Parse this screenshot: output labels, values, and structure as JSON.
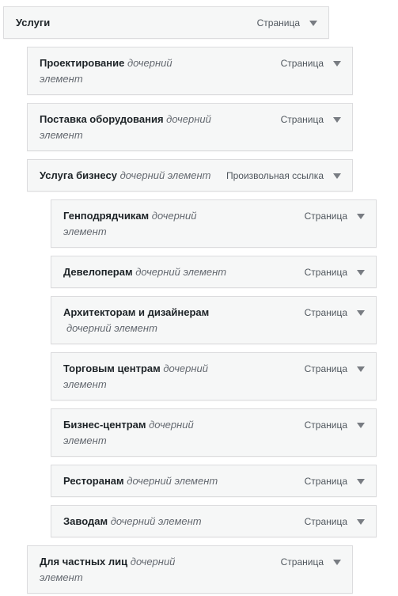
{
  "menu_items": [
    {
      "name": "Услуги",
      "sub": "",
      "type": "Страница",
      "depth": 0
    },
    {
      "name": "Проектирование",
      "sub": "дочерний",
      "sub2": "элемент",
      "type": "Страница",
      "depth": 1
    },
    {
      "name": "Поставка оборудования",
      "sub": "дочерний",
      "sub2": "элемент",
      "type": "Страница",
      "depth": 1
    },
    {
      "name": "Услуга бизнесу",
      "sub": "дочерний элемент",
      "type": "Произвольная ссылка",
      "depth": 1
    },
    {
      "name": "Генподрядчикам",
      "sub": "дочерний",
      "sub2": "элемент",
      "type": "Страница",
      "depth": 2
    },
    {
      "name": "Девелоперам",
      "sub": "дочерний элемент",
      "type": "Страница",
      "depth": 2
    },
    {
      "name": "Архитекторам и дизайнерам",
      "sub": "",
      "sub2": "дочерний элемент",
      "type": "Страница",
      "depth": 2
    },
    {
      "name": "Торговым центрам",
      "sub": "дочерний",
      "sub2": "элемент",
      "type": "Страница",
      "depth": 2
    },
    {
      "name": "Бизнес-центрам",
      "sub": "дочерний",
      "sub2": "элемент",
      "type": "Страница",
      "depth": 2
    },
    {
      "name": "Ресторанам",
      "sub": "дочерний элемент",
      "type": "Страница",
      "depth": 2
    },
    {
      "name": "Заводам",
      "sub": "дочерний элемент",
      "type": "Страница",
      "depth": 2
    },
    {
      "name": "Для частных лиц",
      "sub": "дочерний",
      "sub2": "элемент",
      "type": "Страница",
      "depth": 1
    }
  ],
  "icons": {
    "toggle": "triangle-down-icon"
  }
}
